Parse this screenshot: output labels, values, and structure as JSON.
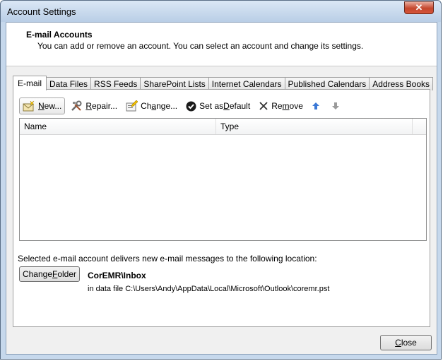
{
  "window": {
    "title": "Account Settings",
    "close_glyph": "✕"
  },
  "header": {
    "title": "E-mail Accounts",
    "description": "You can add or remove an account. You can select an account and change its settings."
  },
  "tabs": [
    {
      "label": "E-mail",
      "active": true
    },
    {
      "label": "Data Files"
    },
    {
      "label": "RSS Feeds"
    },
    {
      "label": "SharePoint Lists"
    },
    {
      "label": "Internet Calendars"
    },
    {
      "label": "Published Calendars"
    },
    {
      "label": "Address Books"
    }
  ],
  "toolbar": {
    "new": {
      "pre": "",
      "key": "N",
      "post": "ew...",
      "icon": "new-account-icon"
    },
    "repair": {
      "pre": "",
      "key": "R",
      "post": "epair...",
      "icon": "repair-tools-icon"
    },
    "change": {
      "pre": "Ch",
      "key": "a",
      "post": "nge...",
      "icon": "change-account-icon"
    },
    "set_default": {
      "pre": "Set as ",
      "key": "D",
      "post": "efault",
      "icon": "checkmark-icon"
    },
    "remove": {
      "pre": "Re",
      "key": "m",
      "post": "ove",
      "icon": "x-remove-icon"
    },
    "move_up_icon": "arrow-up-icon",
    "move_down_icon": "arrow-down-icon"
  },
  "list": {
    "columns": [
      "Name",
      "Type"
    ],
    "rows": []
  },
  "location": {
    "text": "Selected e-mail account delivers new e-mail messages to the following location:",
    "change_folder": {
      "pre": "Change ",
      "key": "F",
      "post": "older"
    },
    "folder_name": "CorEMR\\Inbox",
    "data_file": "in data file C:\\Users\\Andy\\AppData\\Local\\Microsoft\\Outlook\\coremr.pst"
  },
  "close_button": {
    "pre": "",
    "key": "C",
    "post": "lose"
  },
  "colors": {
    "accent_blue": "#3a78d6",
    "close_red": "#c4462d"
  }
}
